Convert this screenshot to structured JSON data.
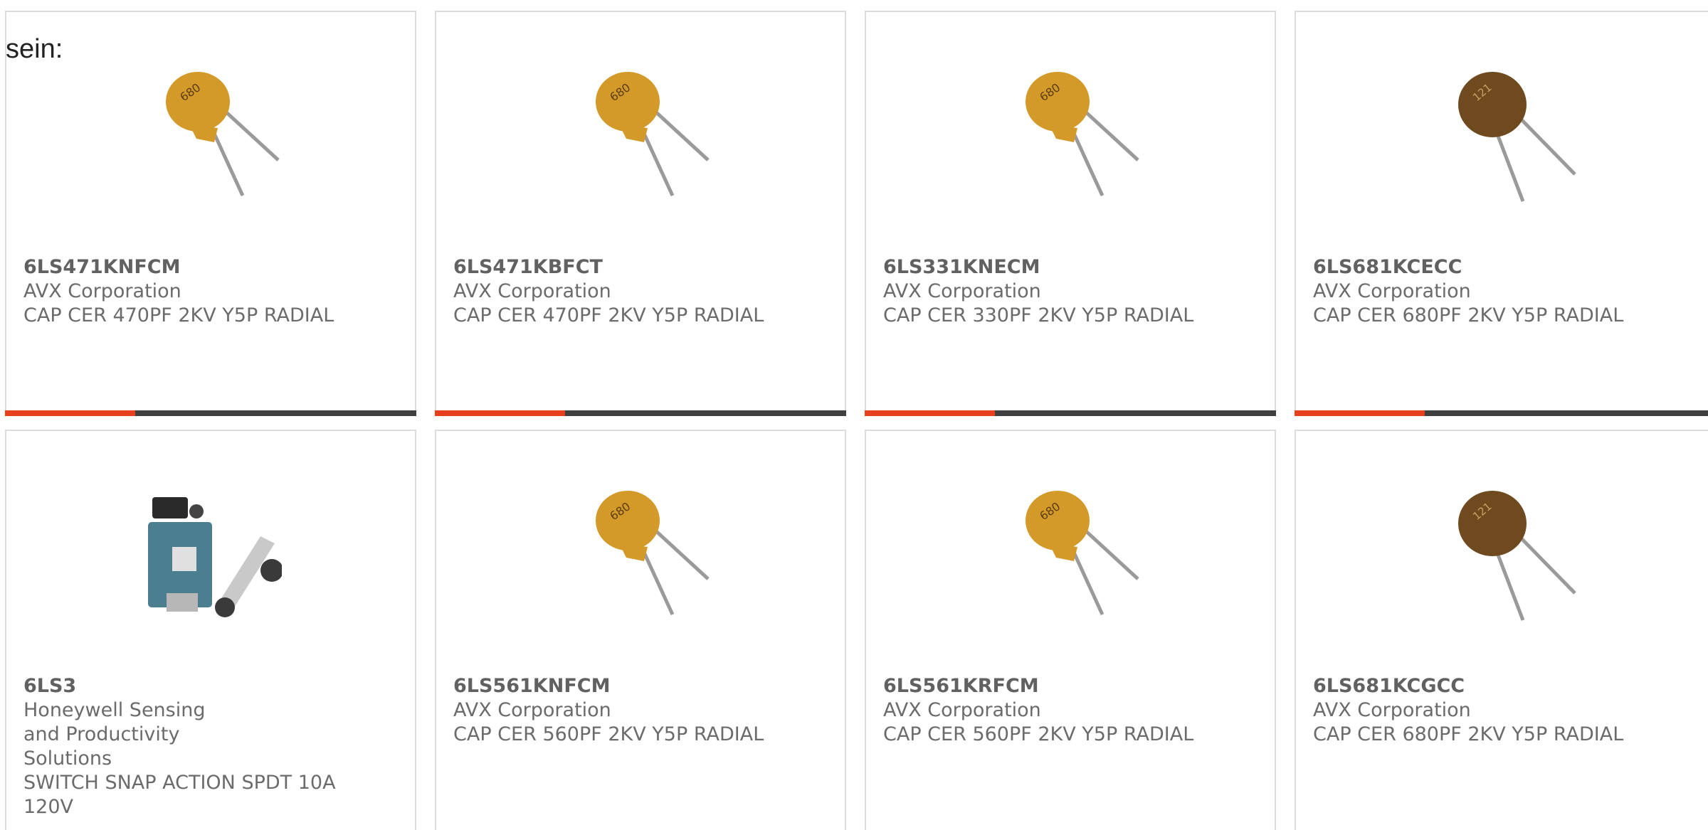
{
  "lead_text": "sein:",
  "products": [
    {
      "part": "6LS471KNFCM",
      "mfr": "AVX Corporation",
      "desc": "CAP CER 470PF 2KV Y5P RADIAL",
      "image": "capacitor-orange-image"
    },
    {
      "part": "6LS471KBFCT",
      "mfr": "AVX Corporation",
      "desc": "CAP CER 470PF 2KV Y5P RADIAL",
      "image": "capacitor-orange-image"
    },
    {
      "part": "6LS331KNECM",
      "mfr": "AVX Corporation",
      "desc": "CAP CER 330PF 2KV Y5P RADIAL",
      "image": "capacitor-orange-image"
    },
    {
      "part": "6LS681KCECC",
      "mfr": "AVX Corporation",
      "desc": "CAP CER 680PF 2KV Y5P RADIAL",
      "image": "capacitor-brown-image"
    },
    {
      "part": "6LS3",
      "mfr": "Honeywell Sensing and Productivity Solutions",
      "desc": "SWITCH SNAP ACTION SPDT 10A 120V",
      "image": "snap-switch-image"
    },
    {
      "part": "6LS561KNFCM",
      "mfr": "AVX Corporation",
      "desc": "CAP CER 560PF 2KV Y5P RADIAL",
      "image": "capacitor-orange-image"
    },
    {
      "part": "6LS561KRFCM",
      "mfr": "AVX Corporation",
      "desc": "CAP CER 560PF 2KV Y5P RADIAL",
      "image": "capacitor-orange-image"
    },
    {
      "part": "6LS681KCGCC",
      "mfr": "AVX Corporation",
      "desc": "CAP CER 680PF 2KV Y5P RADIAL",
      "image": "capacitor-brown-image"
    }
  ],
  "colors": {
    "accent": "#e8401c",
    "bar": "#3f3f3f",
    "cap_orange": "#d39a2a",
    "cap_brown": "#6e4a1e"
  }
}
